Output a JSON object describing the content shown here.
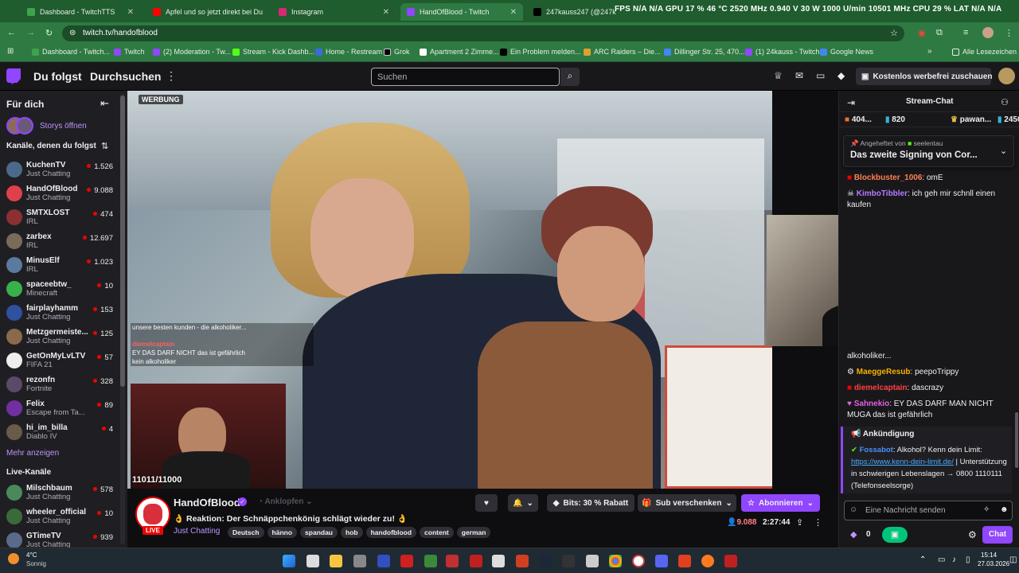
{
  "browser": {
    "tabs": [
      {
        "title": "Dashboard - TwitchTTS",
        "color": "#3fa34d"
      },
      {
        "title": "Apfel und so jetzt direkt bei Du",
        "color": "#ff0000"
      },
      {
        "title": "Instagram",
        "color": "#d62976"
      },
      {
        "title": "HandOfBlood - Twitch",
        "color": "#9146ff"
      },
      {
        "title": "247kauss247 (@247kauss24",
        "color": "#000000"
      }
    ],
    "hwmon": "FPS N/A N/A   GPU 17 % 46 °C 2520 MHz 0.940 V 30 W 1000 U/min 10501 MHz   CPU 29 %   LAT N/A N/A",
    "url": "twitch.tv/handofblood",
    "bookmarks": [
      "Dashboard - Twitch...",
      "Twitch",
      "(2) Moderation - Tw...",
      "Stream - Kick Dashb...",
      "Home - Restream",
      "Grok",
      "Apartment 2 Zimme...",
      "Ein Problem melden...",
      "ARC Raiders – Die...",
      "Dillinger Str. 25, 470...",
      "(1) 24kauss - Twitch",
      "Google News"
    ],
    "all_bookmarks": "Alle Lesezeichen"
  },
  "nav": {
    "following": "Du folgst",
    "browse": "Durchsuchen",
    "search_placeholder": "Suchen",
    "adfree": "Kostenlos werbefrei zuschauen"
  },
  "sidebar": {
    "for_you": "Für dich",
    "stories": "Storys öffnen",
    "followed_header": "Kanäle, denen du folgst",
    "followed": [
      {
        "name": "KuchenTV",
        "game": "Just Chatting",
        "viewers": "1.526",
        "color": "#4b6a8a"
      },
      {
        "name": "HandOfBlood",
        "game": "Just Chatting",
        "viewers": "9.088",
        "color": "#e0404a"
      },
      {
        "name": "SMTXLOST",
        "game": "IRL",
        "viewers": "474",
        "color": "#8a3030"
      },
      {
        "name": "zarbex",
        "game": "IRL",
        "viewers": "12.697",
        "color": "#7a6a5a"
      },
      {
        "name": "MinusElf",
        "game": "IRL",
        "viewers": "1.023",
        "color": "#5a7aa0"
      },
      {
        "name": "spaceebtw_",
        "game": "Minecraft",
        "viewers": "10",
        "color": "#3ab04a"
      },
      {
        "name": "fairplayhamm",
        "game": "Just Chatting",
        "viewers": "153",
        "color": "#3050a0"
      },
      {
        "name": "Metzgermeiste...",
        "game": "Just Chatting",
        "viewers": "125",
        "color": "#8a6a4a"
      },
      {
        "name": "GetOnMyLvLTV",
        "game": "FIFA 21",
        "viewers": "57",
        "color": "#eeeeee"
      },
      {
        "name": "rezonfn",
        "game": "Fortnite",
        "viewers": "328",
        "color": "#5a4a6a"
      },
      {
        "name": "Felix",
        "game": "Escape from Ta...",
        "viewers": "89",
        "color": "#7030a0"
      },
      {
        "name": "hi_im_billa",
        "game": "Diablo IV",
        "viewers": "4",
        "color": "#6a5a4a"
      }
    ],
    "show_more": "Mehr anzeigen",
    "live_header": "Live-Kanäle",
    "live": [
      {
        "name": "Milschbaum",
        "game": "Just Chatting",
        "viewers": "578",
        "color": "#4a8a5a"
      },
      {
        "name": "wheeler_official",
        "game": "Just Chatting",
        "viewers": "10",
        "color": "#3a6a3a"
      },
      {
        "name": "GTimeTV",
        "game": "Just Chatting",
        "viewers": "939",
        "color": "#5a6a8a"
      }
    ]
  },
  "video": {
    "ad_badge": "WERBUNG",
    "overlay_chat": [
      {
        "user": "",
        "text": "unsere besten kunden - die alkoholiker..."
      },
      {
        "user": "",
        "text": ""
      },
      {
        "user": "diemelcaptain",
        "text": ""
      },
      {
        "user": "",
        "text": "EY DAS DARF NICHT das ist gefährlich"
      },
      {
        "user": "",
        "text": "kein alkoholiker"
      }
    ],
    "counter": "11011/11000"
  },
  "info": {
    "channel": "HandOfBlood",
    "pin": "Anklopfen",
    "title": "Reaktion: Der Schnäppchenkönig schlägt wieder zu!",
    "category": "Just Chatting",
    "tags": [
      "Deutsch",
      "hänno",
      "spandau",
      "hob",
      "handofblood",
      "content",
      "german"
    ],
    "bits": "Bits: 30 % Rabatt",
    "gift": "Sub verschenken",
    "subscribe": "Abonnieren",
    "viewers": "9.088",
    "uptime": "2:27:44",
    "live_badge": "LIVE"
  },
  "chat": {
    "header": "Stream-Chat",
    "leaderboard": [
      {
        "label": "404...",
        "color": "#f07030"
      },
      {
        "label": "820",
        "color": "#3ab0e0"
      },
      {
        "label": "pawan...",
        "color": "#e0c040"
      },
      {
        "label": "2450",
        "color": "#3ab0e0"
      }
    ],
    "pinned_by": "Angeheftet von",
    "pinned_user": "seelentau",
    "pinned_text": "Das zweite Signing von Cor...",
    "messages": [
      {
        "user": "Blockbuster_1006",
        "color": "#ff7f50",
        "text": ": omE"
      },
      {
        "user": "KimboTibbler",
        "color": "#b57bff",
        "text": ": ich geh mir schnll einen kaufen"
      },
      {
        "user": "",
        "color": "#ffffff",
        "text": "alkoholiker..."
      },
      {
        "user": "MaeggeResub",
        "color": "#f4b000",
        "text": ": peepoTrippy"
      },
      {
        "user": "diemelcaptain",
        "color": "#ff4040",
        "text": ": dascrazy"
      },
      {
        "user": "Sahnekio",
        "color": "#e060e0",
        "text": ": EY DAS DARF MAN NICHT MUGA das ist gefährlich"
      }
    ],
    "announcement_label": "Ankündigung",
    "announcement_user": "Fossabot",
    "announcement_text": ": Alkohol? Kenn dein Limit:",
    "announcement_link": "https://www.kenn-dein-limit.de/",
    "announcement_rest": "Unterstützung in schwierigen Lebenslagen → 0800 1110111 (Telefonseelsorge)",
    "input_placeholder": "Eine Nachricht senden",
    "points": "0",
    "send": "Chat"
  },
  "taskbar": {
    "weather_temp": "4°C",
    "weather_desc": "Sonnig",
    "time": "15:14",
    "date": "27.03.2026"
  }
}
